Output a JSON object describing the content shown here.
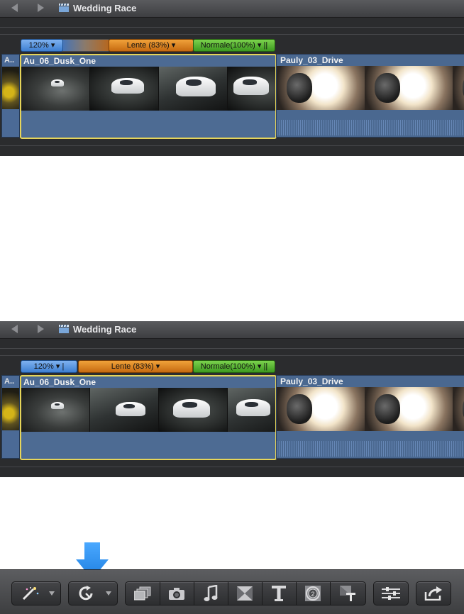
{
  "panels": [
    {
      "title": "Wedding Race",
      "speed_segments": {
        "blue": "120%",
        "orange": "Lente (83%)",
        "green": "Normale(100%)"
      },
      "clip_left_label": "A..",
      "main_clip": "Au_06_Dusk_One",
      "second_clip": "Pauly_03_Drive"
    },
    {
      "title": "Wedding Race",
      "speed_segments": {
        "blue": "120%",
        "orange": "Lente (83%)",
        "green": "Normale(100%)"
      },
      "clip_left_label": "A..",
      "main_clip": "Au_06_Dusk_One",
      "second_clip": "Pauly_03_Drive"
    }
  ],
  "toolbar": {
    "buttons": [
      {
        "icon": "magic-wand-icon",
        "has_dropdown": true
      },
      {
        "icon": "retime-icon",
        "has_dropdown": true
      },
      {
        "icon": "photos-browser-icon"
      },
      {
        "icon": "camera-icon"
      },
      {
        "icon": "music-note-icon"
      },
      {
        "icon": "transitions-icon"
      },
      {
        "icon": "titles-icon"
      },
      {
        "icon": "generators-icon"
      },
      {
        "icon": "themes-icon"
      },
      {
        "icon": "inspector-icon"
      },
      {
        "icon": "share-icon"
      }
    ],
    "highlight_color": "#1e8cf0"
  }
}
